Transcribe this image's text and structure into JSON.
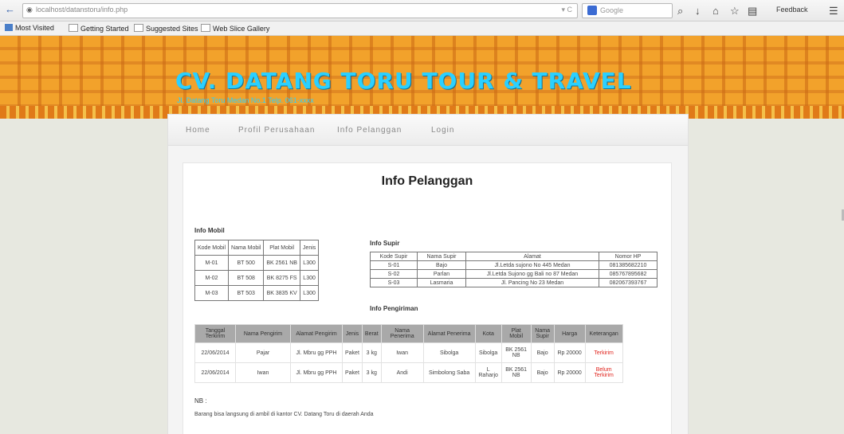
{
  "browser": {
    "url": "localhost/datanstoru/info.php",
    "search_placeholder": "Google",
    "feedback_label": "Feedback",
    "bookmarks": [
      "Most Visited",
      "Getting Started",
      "Suggested Sites",
      "Web Slice Gallery"
    ]
  },
  "banner": {
    "title": "CV. DATANG TORU TOUR & TRAVEL",
    "subtitle": "Jl. Datang Toru Medan No.1 Telp. 061-xxxx"
  },
  "menu": [
    "Home",
    "Profil Perusahaan",
    "Info Pelanggan",
    "Login"
  ],
  "page_title": "Info Pelanggan",
  "info_mobil": {
    "label": "Info Mobil",
    "headers": [
      "Kode Mobil",
      "Nama Mobil",
      "Plat Mobil",
      "Jenis"
    ],
    "rows": [
      [
        "M-01",
        "BT 500",
        "BK 2561 NB",
        "L300"
      ],
      [
        "M-02",
        "BT 508",
        "BK 8275 FS",
        "L300"
      ],
      [
        "M-03",
        "BT 503",
        "BK 3835 KV",
        "L300"
      ]
    ]
  },
  "info_supir": {
    "label": "Info Supir",
    "headers": [
      "Kode Supir",
      "Nama Supir",
      "Alamat",
      "Nomor HP"
    ],
    "rows": [
      [
        "S-01",
        "Bajo",
        "Jl.Letda sujono No 445 Medan",
        "081385682210"
      ],
      [
        "S-02",
        "Parlan",
        "Jl.Letda Sujono gg Bali no 87 Medan",
        "085767895682"
      ],
      [
        "S-03",
        "Lasmaria",
        "Jl. Pancing No 23 Medan",
        "082067393767"
      ]
    ]
  },
  "info_pengiriman": {
    "label": "Info Pengiriman",
    "headers": [
      "Tanggal Terkirim",
      "Nama Pengirim",
      "Alamat Pengirim",
      "Jenis",
      "Berat",
      "Nama Penerima",
      "Alamat Penerima",
      "Kota",
      "Plat Mobil",
      "Nama Supir",
      "Harga",
      "Keterangan"
    ],
    "rows": [
      [
        "22/06/2014",
        "Pajar",
        "Jl. Mbru gg PPH",
        "Paket",
        "3 kg",
        "Iwan",
        "Sibolga",
        "Sibolga",
        "BK 2561 NB",
        "Bajo",
        "Rp 20000",
        "Terkirim"
      ],
      [
        "22/06/2014",
        "Iwan",
        "Jl. Mbru gg PPH",
        "Paket",
        "3 kg",
        "Andi",
        "Simbolong Saba",
        "L Raharjo",
        "BK 2561 NB",
        "Bajo",
        "Rp 20000",
        "Belum Terkirim"
      ]
    ]
  },
  "note": {
    "label": "NB :",
    "text": "Barang bisa langsung di ambil di kantor CV. Datang Toru di daerah Anda"
  }
}
